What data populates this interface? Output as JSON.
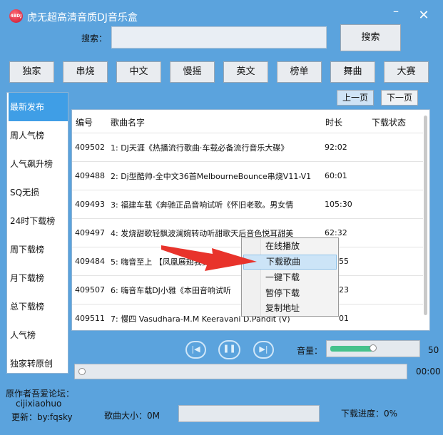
{
  "window": {
    "title": "虎无超高清音质DJ音乐盒",
    "logo_text": "4BDJ"
  },
  "search": {
    "label": "搜索：",
    "value": "",
    "button_label": "搜索"
  },
  "categories": [
    "独家",
    "串烧",
    "中文",
    "慢摇",
    "英文",
    "榜单",
    "舞曲",
    "大赛"
  ],
  "paging": {
    "prev_label": "上一页",
    "next_label": "下一页"
  },
  "sidebar": {
    "items": [
      {
        "label": "最新发布",
        "active": true
      },
      {
        "label": "周人气榜"
      },
      {
        "label": "人气飙升榜"
      },
      {
        "label": "SQ无损"
      },
      {
        "label": "24时下载榜"
      },
      {
        "label": "周下载榜"
      },
      {
        "label": "月下载榜"
      },
      {
        "label": "总下载榜"
      },
      {
        "label": "人气榜"
      },
      {
        "label": "独家转原创"
      }
    ]
  },
  "table": {
    "headers": {
      "num": "编号",
      "name": "歌曲名字",
      "duration": "时长",
      "status": "下载状态"
    },
    "rows": [
      {
        "num": "409502",
        "name": "1: DJ天涯《热播流行歌曲·车载必备流行音乐大碟》",
        "duration": "92:02"
      },
      {
        "num": "409488",
        "name": "2: Dj型酷帅-全中文36首MelbourneBounce串烧V11-V1",
        "duration": "60:01"
      },
      {
        "num": "409493",
        "name": "3: 福建车载《奔驰正品音响试听《怀旧老歌。男女情",
        "duration": "105:30"
      },
      {
        "num": "409497",
        "name": "4: 发烧甜歌轻飘波澜婉转动听甜歌天后音色悦耳甜美",
        "duration": "62:32"
      },
      {
        "num": "409484",
        "name": "5: 嗨音至上   【凤凰展翅我要之",
        "duration": "55"
      },
      {
        "num": "409507",
        "name": "6: 嗨音车载DJ小雅《本田音响试听",
        "duration": "23"
      },
      {
        "num": "409511",
        "name": "7: 慢四    Vasudhara-M.M  Keeravani  D.Pandit (V)",
        "duration": "01"
      }
    ]
  },
  "context_menu": {
    "items": [
      "在线播放",
      "下载歌曲",
      "一键下载",
      "暂停下载",
      "复制地址"
    ],
    "highlighted": 1
  },
  "player": {
    "volume_label": "音量：",
    "volume": 50,
    "volume_value": "50",
    "time": "00:00",
    "progress": 0
  },
  "footer": {
    "author_label": "原作者吾爱论坛：",
    "author": "cijixiaohuo",
    "update": "更新：by:fqsky",
    "size": "歌曲大小：0M",
    "download_progress": "下载进度：0%"
  },
  "colors": {
    "background": "#5ba3dd",
    "sidebar_active": "#3f9ee6",
    "volume_fill": "#45c28c",
    "arrow": "#e8332b"
  }
}
